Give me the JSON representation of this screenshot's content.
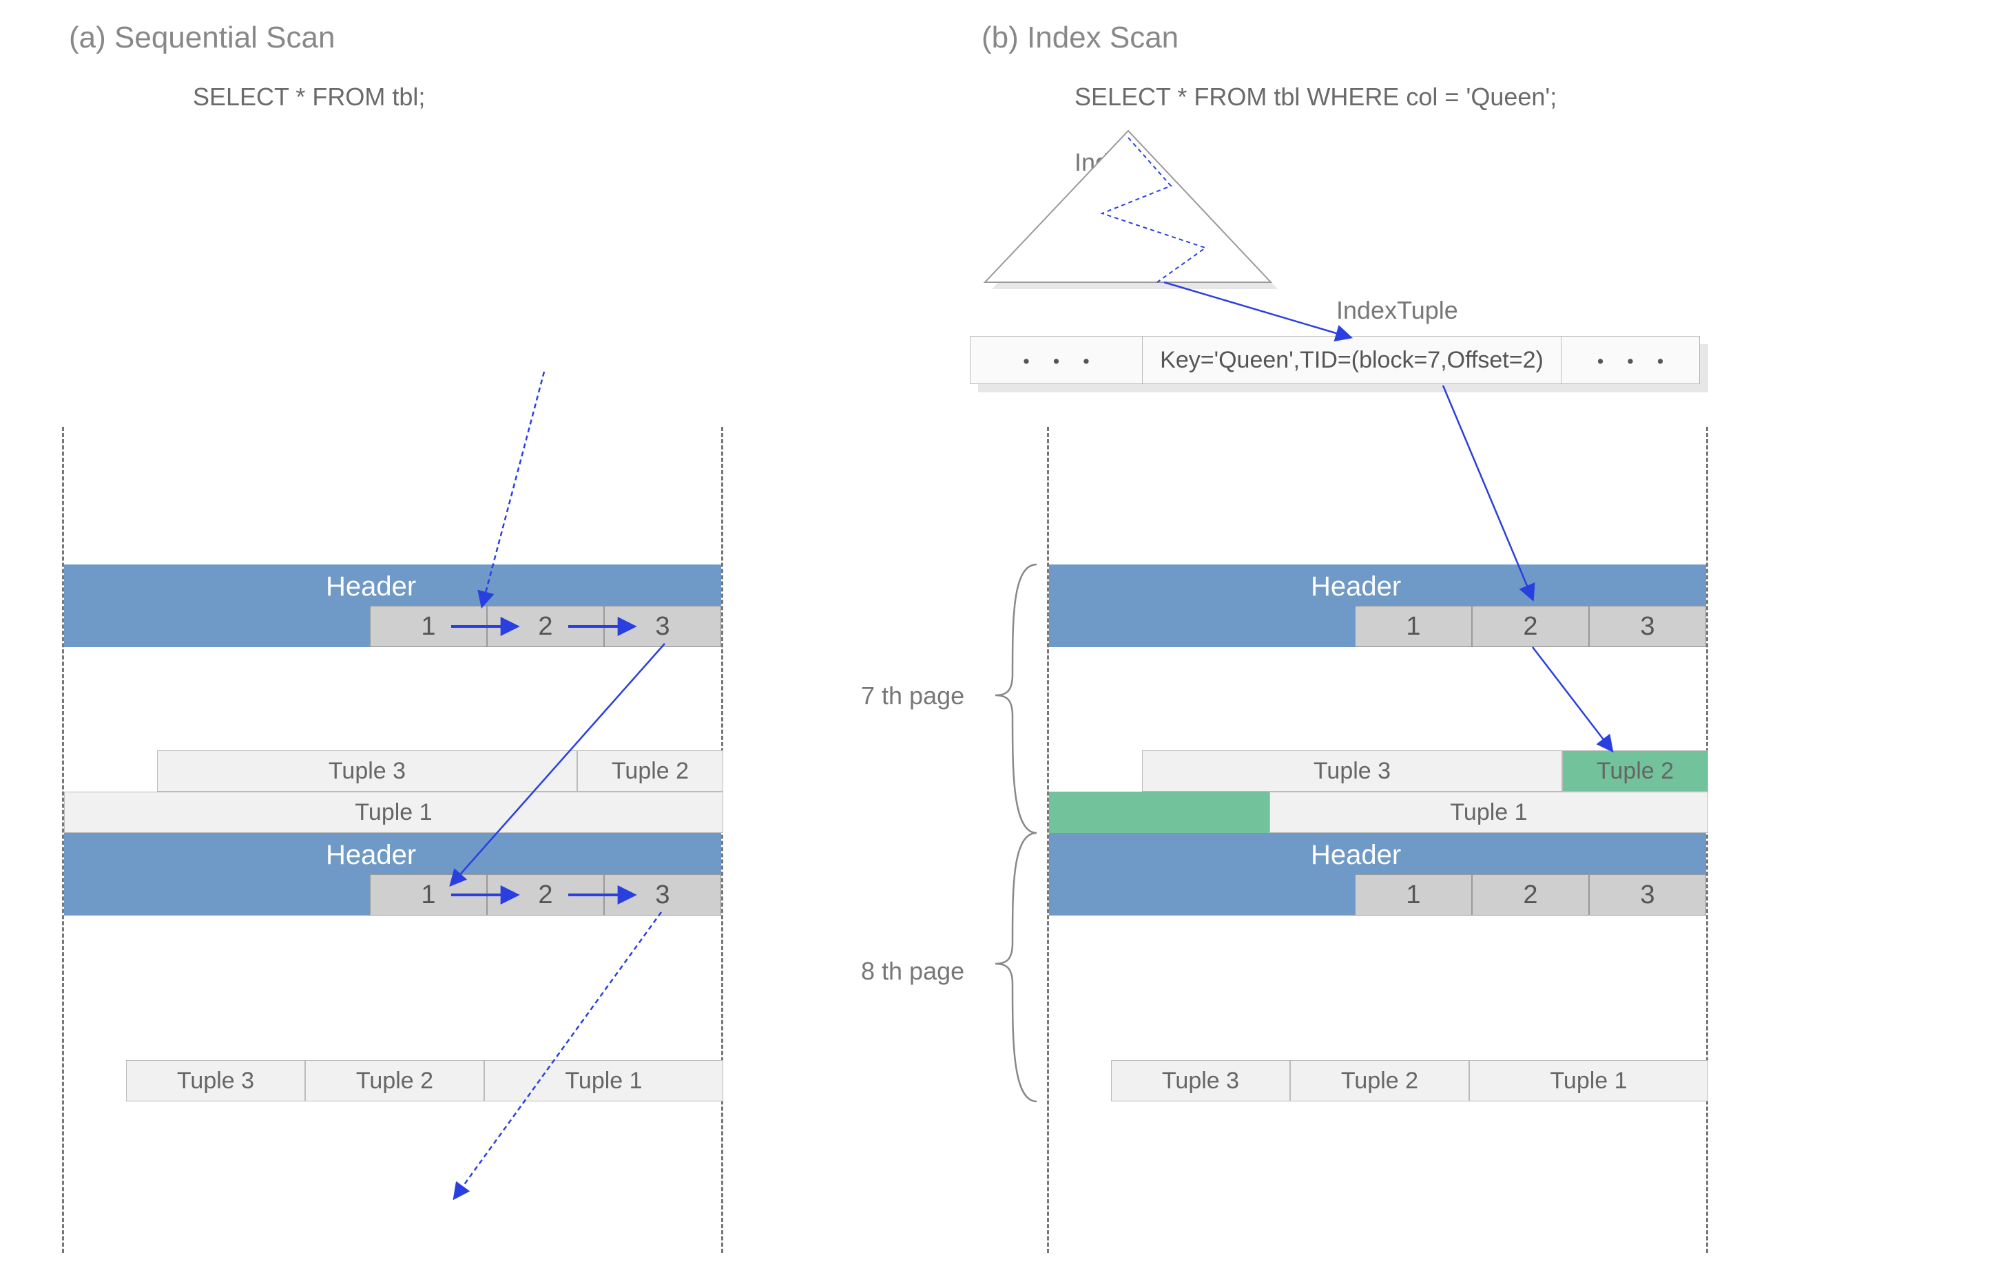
{
  "left": {
    "title": "(a) Sequential Scan",
    "sql": "SELECT * FROM tbl;",
    "header_label": "Header",
    "pointers": [
      "1",
      "2",
      "3"
    ],
    "upper_tuples_row1": [
      "Tuple 3",
      "Tuple 2"
    ],
    "upper_tuples_row2": "Tuple 1",
    "lower_tuples": [
      "Tuple 3",
      "Tuple 2",
      "Tuple 1"
    ]
  },
  "right": {
    "title": "(b) Index Scan",
    "sql": "SELECT * FROM tbl WHERE  col = 'Queen';",
    "index_label": "Index",
    "index_tuple_label": "IndexTuple",
    "index_row_left": "・ ・ ・",
    "index_row_mid": "Key='Queen',TID=(block=7,Offset=2)",
    "index_row_right": "・ ・ ・",
    "header_label": "Header",
    "pointers": [
      "1",
      "2",
      "3"
    ],
    "page7_label": "7 th page",
    "page8_label": "8 th page",
    "p7_tuples_row1": [
      "Tuple 3",
      "Tuple 2"
    ],
    "p7_tuples_row2": "Tuple 1",
    "p8_tuples": [
      "Tuple 3",
      "Tuple 2",
      "Tuple 1"
    ]
  }
}
